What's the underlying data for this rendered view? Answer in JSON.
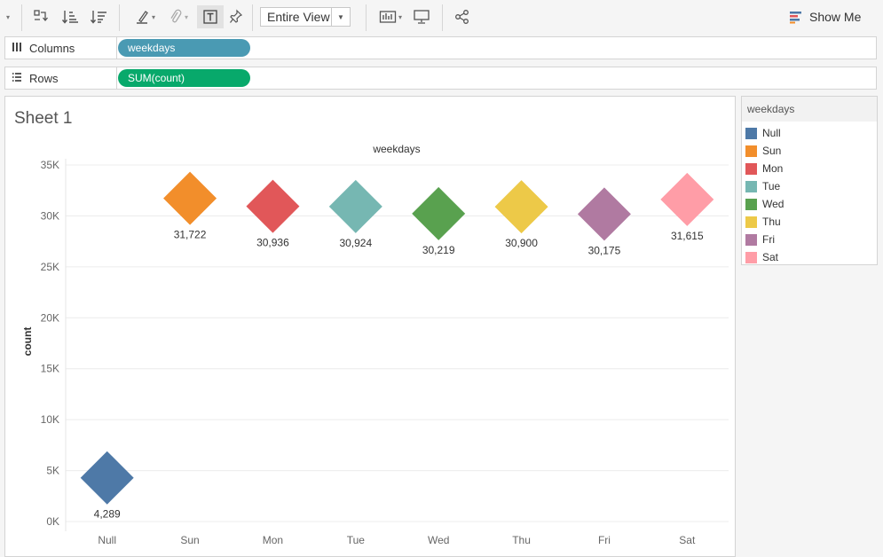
{
  "toolbar": {
    "fit_label": "Entire View",
    "show_me_label": "Show Me"
  },
  "shelves": {
    "columns": {
      "label": "Columns",
      "pill": "weekdays",
      "pill_color": "#4a9ab3"
    },
    "rows": {
      "label": "Rows",
      "pill": "SUM(count)",
      "pill_color": "#08a96b"
    }
  },
  "sheet": {
    "title": "Sheet 1"
  },
  "legend": {
    "title": "weekdays",
    "items": [
      {
        "label": "Null",
        "color": "#4e79a7"
      },
      {
        "label": "Sun",
        "color": "#f28e2b"
      },
      {
        "label": "Mon",
        "color": "#e15759"
      },
      {
        "label": "Tue",
        "color": "#76b7b2"
      },
      {
        "label": "Wed",
        "color": "#59a14f"
      },
      {
        "label": "Thu",
        "color": "#edc948"
      },
      {
        "label": "Fri",
        "color": "#b07aa1"
      },
      {
        "label": "Sat",
        "color": "#ff9da7"
      }
    ]
  },
  "chart_data": {
    "type": "scatter",
    "mark": "diamond",
    "title": "weekdays",
    "xlabel": "",
    "ylabel": "count",
    "categories": [
      "Null",
      "Sun",
      "Mon",
      "Tue",
      "Wed",
      "Thu",
      "Fri",
      "Sat"
    ],
    "values": [
      4289,
      31722,
      30936,
      30924,
      30219,
      30900,
      30175,
      31615
    ],
    "value_labels": [
      "4,289",
      "31,722",
      "30,936",
      "30,924",
      "30,219",
      "30,900",
      "30,175",
      "31,615"
    ],
    "colors": [
      "#4e79a7",
      "#f28e2b",
      "#e15759",
      "#76b7b2",
      "#59a14f",
      "#edc948",
      "#b07aa1",
      "#ff9da7"
    ],
    "ylim": [
      0,
      35000
    ],
    "yticks": [
      0,
      5000,
      10000,
      15000,
      20000,
      25000,
      30000,
      35000
    ],
    "ytick_labels": [
      "0K",
      "5K",
      "10K",
      "15K",
      "20K",
      "25K",
      "30K",
      "35K"
    ],
    "grid": true,
    "legend_position": "right"
  }
}
